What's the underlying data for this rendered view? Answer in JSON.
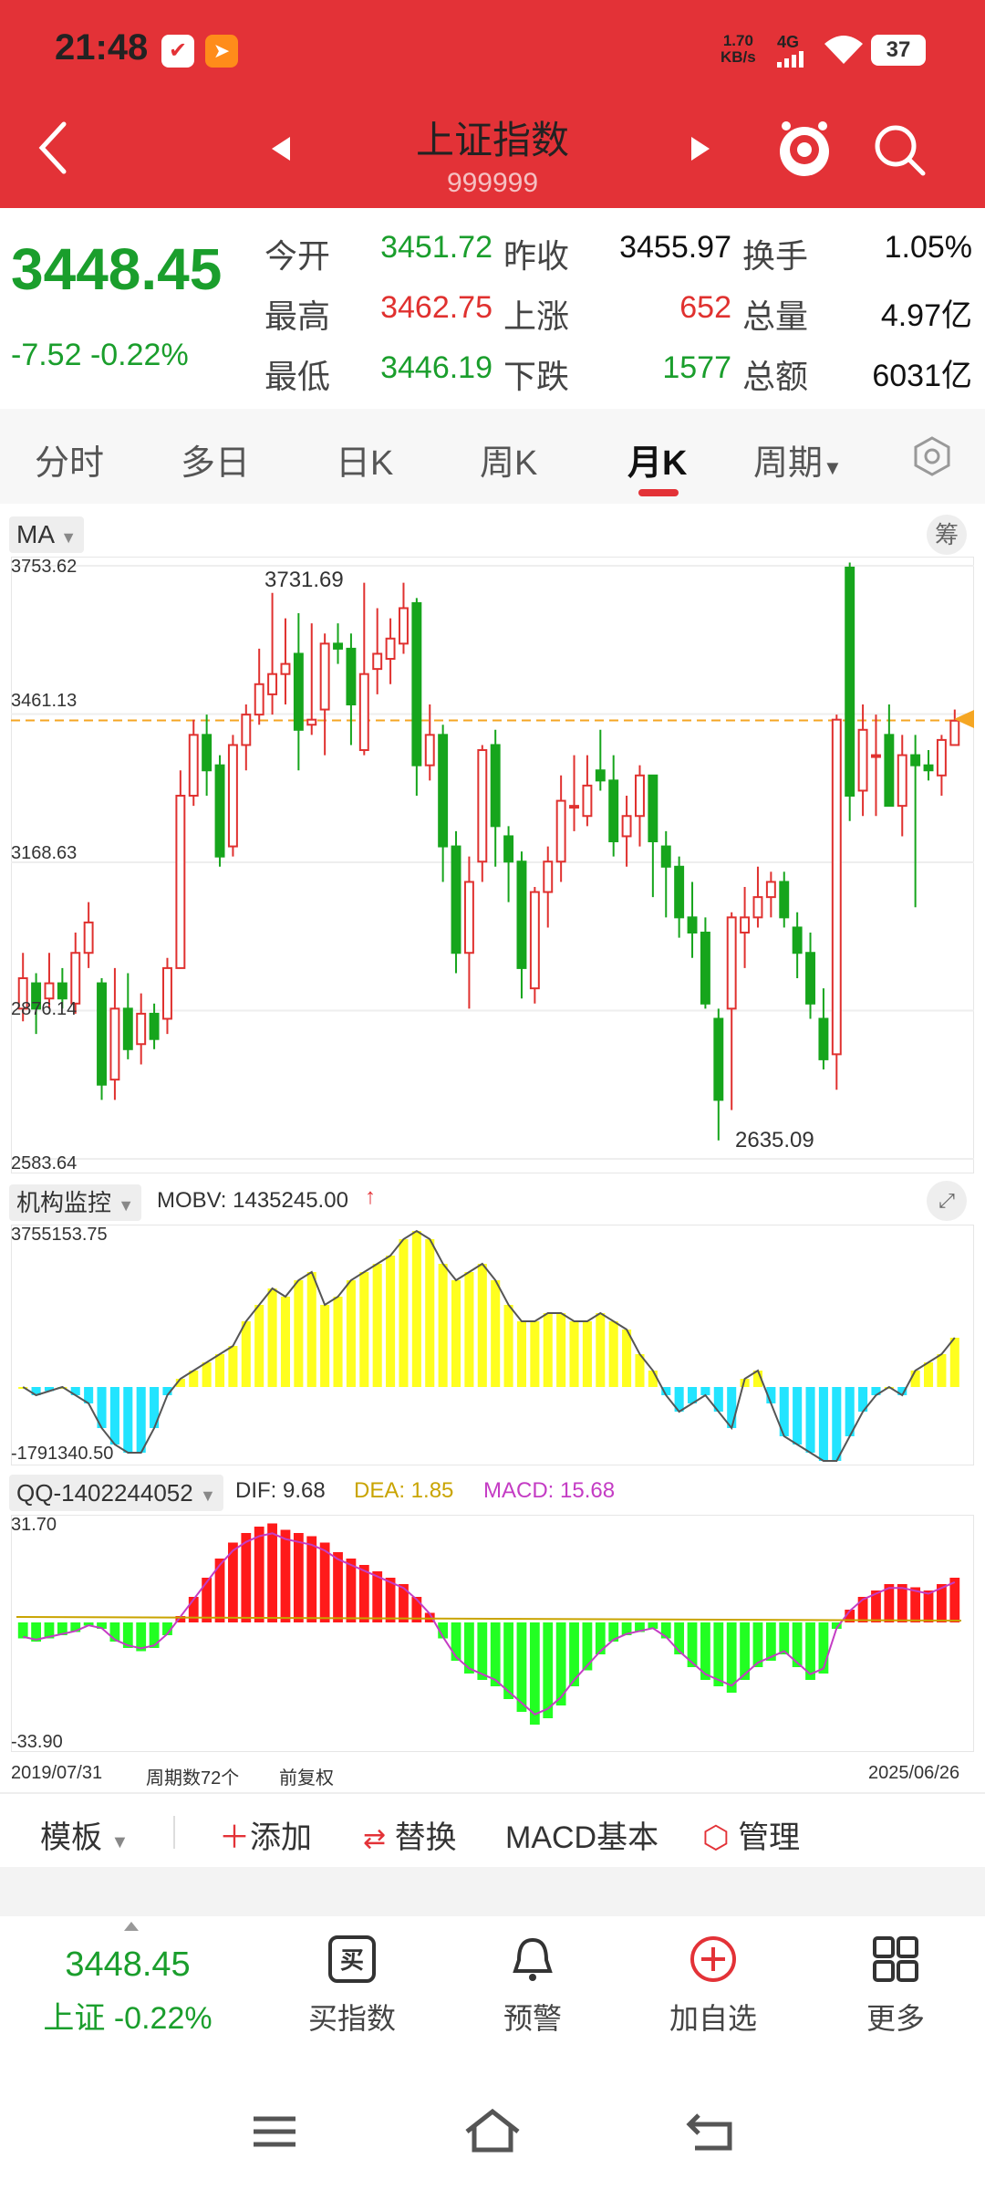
{
  "status_bar": {
    "time": "21:48",
    "net_speed_value": "1.70",
    "net_speed_unit": "KB/s",
    "network": "4G",
    "battery": "37"
  },
  "header": {
    "title": "上证指数",
    "code": "999999"
  },
  "quote": {
    "price": "3448.45",
    "change": "-7.52",
    "change_pct": "-0.22%",
    "fields": [
      {
        "label": "今开",
        "value": "3451.72"
      },
      {
        "label": "最高",
        "value": "3462.75"
      },
      {
        "label": "最低",
        "value": "3446.19"
      },
      {
        "label": "昨收",
        "value": "3455.97"
      },
      {
        "label": "上涨",
        "value": "652"
      },
      {
        "label": "下跌",
        "value": "1577"
      },
      {
        "label": "换手",
        "value": "1.05%"
      },
      {
        "label": "总量",
        "value": "4.97亿"
      },
      {
        "label": "总额",
        "value": "6031亿"
      }
    ]
  },
  "tabs": [
    "分时",
    "多日",
    "日K",
    "周K",
    "月K",
    "周期"
  ],
  "active_tab": "月K",
  "chart": {
    "indicator": "MA",
    "chip_label": "筹",
    "y_labels": [
      "3753.62",
      "3461.13",
      "3168.63",
      "2876.14",
      "2583.64"
    ],
    "max_label": "3731.69",
    "min_label": "2635.09"
  },
  "mobv": {
    "name": "机构监控",
    "label": "MOBV: 1435245.00",
    "max": "3755153.75",
    "min": "-1791340.50"
  },
  "macd": {
    "name": "QQ-1402244052",
    "dif": "DIF: 9.68",
    "dea": "DEA: 1.85",
    "macd": "MACD: 15.68",
    "max": "31.70",
    "min": "-33.90",
    "start_date": "2019/07/31",
    "end_date": "2025/06/26",
    "period_count": "周期数72个",
    "adjust": "前复权"
  },
  "toolbar": {
    "template": "模板",
    "add": "添加",
    "replace": "替换",
    "basic": "MACD基本",
    "manage": "管理"
  },
  "bottom_nav": {
    "price": "3448.45",
    "price_sub": "上证 -0.22%",
    "items": [
      "买指数",
      "预警",
      "加自选",
      "更多"
    ]
  },
  "chart_data": {
    "type": "candlestick",
    "series": [
      {
        "name": "kline",
        "values": [
          [
            2880,
            2940,
            2990,
            2855
          ],
          [
            2930,
            2880,
            2950,
            2830
          ],
          [
            2900,
            2930,
            2990,
            2880
          ],
          [
            2930,
            2900,
            2960,
            2880
          ],
          [
            2890,
            2990,
            3030,
            2870
          ],
          [
            2990,
            3050,
            3090,
            2960
          ],
          [
            2930,
            2730,
            2940,
            2700
          ],
          [
            2740,
            2880,
            2960,
            2700
          ],
          [
            2880,
            2800,
            2950,
            2780
          ],
          [
            2810,
            2870,
            2910,
            2770
          ],
          [
            2870,
            2820,
            2890,
            2800
          ],
          [
            2860,
            2960,
            2980,
            2830
          ],
          [
            2960,
            3300,
            3350,
            2960
          ],
          [
            3300,
            3420,
            3450,
            3280
          ],
          [
            3420,
            3350,
            3460,
            3300
          ],
          [
            3360,
            3180,
            3380,
            3160
          ],
          [
            3200,
            3400,
            3420,
            3180
          ],
          [
            3400,
            3460,
            3480,
            3350
          ],
          [
            3460,
            3520,
            3590,
            3440
          ],
          [
            3500,
            3540,
            3700,
            3460
          ],
          [
            3540,
            3560,
            3650,
            3480
          ],
          [
            3580,
            3430,
            3660,
            3350
          ],
          [
            3440,
            3450,
            3640,
            3420
          ],
          [
            3470,
            3600,
            3620,
            3380
          ],
          [
            3600,
            3590,
            3640,
            3560
          ],
          [
            3590,
            3480,
            3620,
            3400
          ],
          [
            3390,
            3540,
            3720,
            3380
          ],
          [
            3550,
            3580,
            3670,
            3500
          ],
          [
            3570,
            3610,
            3650,
            3520
          ],
          [
            3600,
            3670,
            3720,
            3580
          ],
          [
            3680,
            3360,
            3690,
            3300
          ],
          [
            3360,
            3420,
            3480,
            3330
          ],
          [
            3420,
            3200,
            3440,
            3130
          ],
          [
            3200,
            2990,
            3230,
            2950
          ],
          [
            2990,
            3130,
            3180,
            2880
          ],
          [
            3170,
            3390,
            3400,
            3130
          ],
          [
            3400,
            3240,
            3430,
            3160
          ],
          [
            3220,
            3170,
            3240,
            3090
          ],
          [
            3170,
            2960,
            3190,
            2900
          ],
          [
            2920,
            3110,
            3120,
            2890
          ],
          [
            3110,
            3170,
            3200,
            3040
          ],
          [
            3170,
            3290,
            3340,
            3130
          ],
          [
            3280,
            3280,
            3380,
            3230
          ],
          [
            3260,
            3320,
            3380,
            3240
          ],
          [
            3350,
            3330,
            3430,
            3310
          ],
          [
            3330,
            3210,
            3380,
            3180
          ],
          [
            3220,
            3260,
            3300,
            3160
          ],
          [
            3260,
            3340,
            3360,
            3200
          ],
          [
            3340,
            3210,
            3340,
            3100
          ],
          [
            3200,
            3160,
            3230,
            3060
          ],
          [
            3160,
            3060,
            3180,
            3020
          ],
          [
            3060,
            3030,
            3130,
            2980
          ],
          [
            3030,
            2890,
            3060,
            2880
          ],
          [
            2860,
            2700,
            2880,
            2620
          ],
          [
            2880,
            3060,
            3070,
            2680
          ],
          [
            3030,
            3060,
            3120,
            2960
          ],
          [
            3060,
            3100,
            3160,
            3040
          ],
          [
            3100,
            3130,
            3150,
            3060
          ],
          [
            3130,
            3060,
            3150,
            3040
          ],
          [
            3040,
            2990,
            3070,
            2940
          ],
          [
            2990,
            2890,
            3030,
            2860
          ],
          [
            2860,
            2780,
            2920,
            2760
          ],
          [
            2790,
            3450,
            3460,
            2720
          ],
          [
            3750,
            3300,
            3760,
            3250
          ],
          [
            3310,
            3430,
            3480,
            3260
          ],
          [
            3380,
            3380,
            3460,
            3260
          ],
          [
            3420,
            3280,
            3480,
            3280
          ],
          [
            3280,
            3380,
            3420,
            3220
          ],
          [
            3380,
            3360,
            3420,
            3080
          ],
          [
            3360,
            3350,
            3390,
            3330
          ],
          [
            3340,
            3410,
            3420,
            3300
          ],
          [
            3400,
            3448,
            3470,
            3400
          ]
        ]
      },
      {
        "name": "MOBV",
        "values": [
          0,
          -10,
          -5,
          0,
          -10,
          -20,
          -50,
          -70,
          -80,
          -80,
          -50,
          -10,
          10,
          20,
          30,
          40,
          50,
          80,
          100,
          120,
          110,
          130,
          140,
          100,
          110,
          130,
          140,
          150,
          160,
          180,
          190,
          180,
          150,
          130,
          140,
          150,
          130,
          100,
          80,
          80,
          90,
          90,
          80,
          80,
          90,
          80,
          70,
          40,
          20,
          -10,
          -30,
          -20,
          -10,
          -30,
          -50,
          10,
          20,
          -20,
          -60,
          -70,
          -80,
          -90,
          -90,
          -60,
          -30,
          -10,
          0,
          -10,
          20,
          30,
          40,
          60
        ]
      },
      {
        "name": "MACD",
        "values": [
          -5,
          -6,
          -5,
          -4,
          -3,
          -1,
          -2,
          -6,
          -8,
          -9,
          -8,
          -4,
          2,
          8,
          14,
          20,
          25,
          28,
          30,
          31,
          29,
          28,
          27,
          25,
          22,
          20,
          18,
          16,
          14,
          12,
          8,
          3,
          -5,
          -12,
          -16,
          -18,
          -20,
          -24,
          -28,
          -32,
          -30,
          -26,
          -20,
          -15,
          -10,
          -6,
          -4,
          -3,
          -2,
          -5,
          -10,
          -14,
          -18,
          -20,
          -22,
          -18,
          -14,
          -12,
          -10,
          -14,
          -18,
          -16,
          -2,
          4,
          8,
          10,
          12,
          12,
          11,
          10,
          12,
          14
        ]
      }
    ]
  }
}
